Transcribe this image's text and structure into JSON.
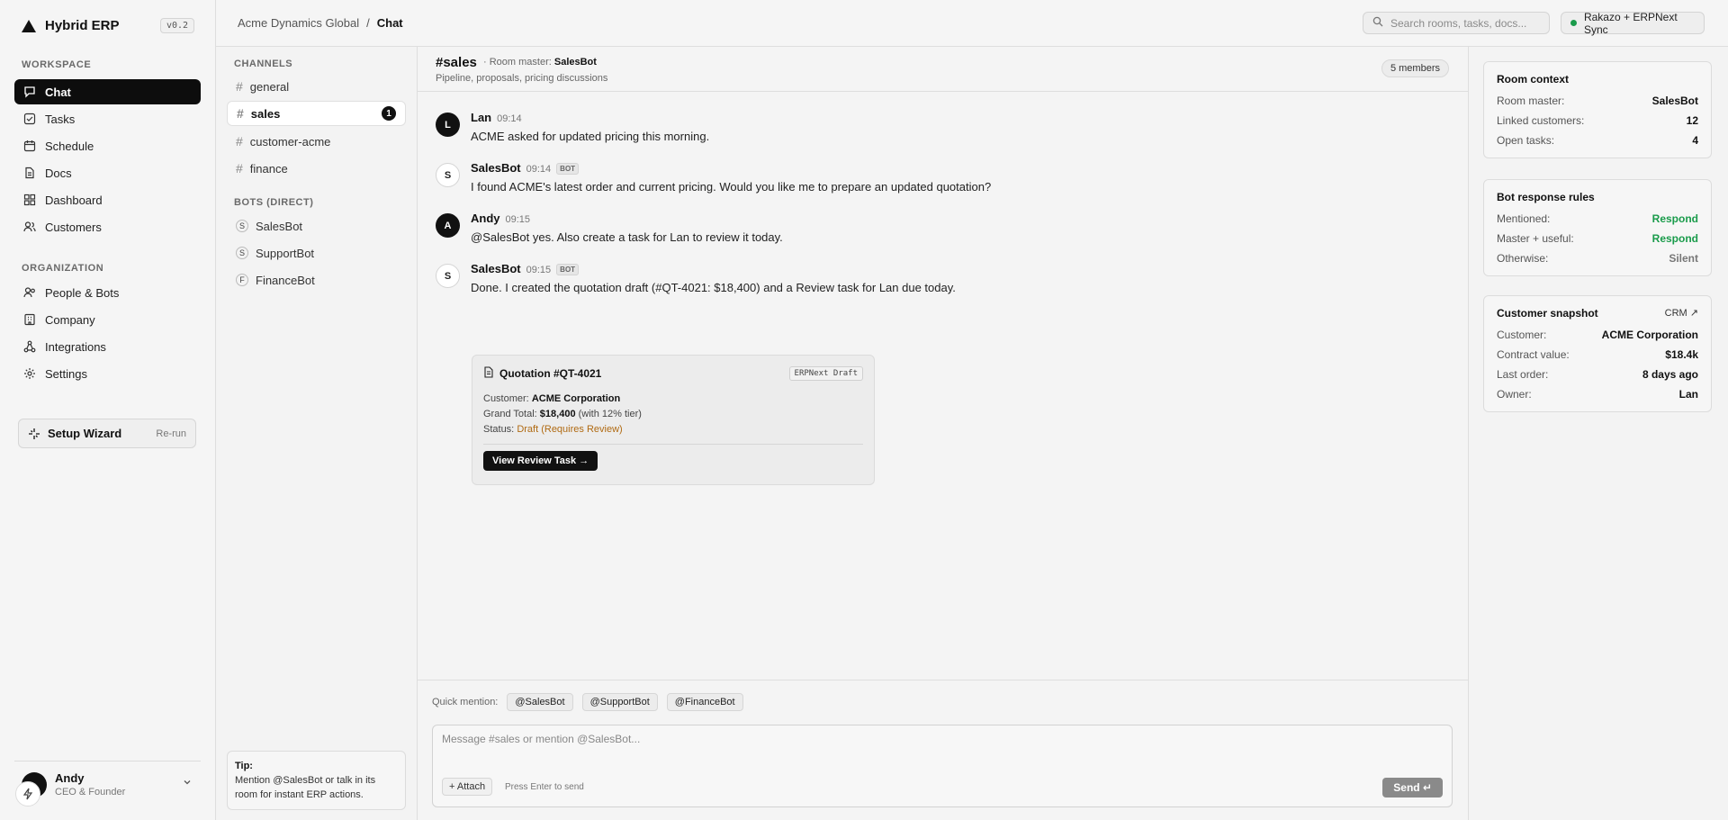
{
  "app": {
    "name": "Hybrid ERP",
    "version": "v0.2"
  },
  "sidebar": {
    "workspace_label": "WORKSPACE",
    "workspace_items": [
      {
        "label": "Chat",
        "icon": "chat-icon"
      },
      {
        "label": "Tasks",
        "icon": "tasks-icon"
      },
      {
        "label": "Schedule",
        "icon": "calendar-icon"
      },
      {
        "label": "Docs",
        "icon": "document-icon"
      },
      {
        "label": "Dashboard",
        "icon": "dashboard-icon"
      },
      {
        "label": "Customers",
        "icon": "users-icon"
      }
    ],
    "organization_label": "ORGANIZATION",
    "organization_items": [
      {
        "label": "People & Bots",
        "icon": "people-icon"
      },
      {
        "label": "Company",
        "icon": "building-icon"
      },
      {
        "label": "Integrations",
        "icon": "integrations-icon"
      },
      {
        "label": "Settings",
        "icon": "gear-icon"
      }
    ],
    "setup": {
      "label": "Setup Wizard",
      "action": "Re-run"
    },
    "user": {
      "name": "Andy",
      "role": "CEO & Founder"
    }
  },
  "topbar": {
    "breadcrumb": [
      "Acme Dynamics Global",
      "/",
      "Chat"
    ],
    "search_placeholder": "Search rooms, tasks, docs...",
    "sync_label": "Rakazo + ERPNext Sync"
  },
  "channels": {
    "channels_label": "CHANNELS",
    "channel_items": [
      {
        "label": "general"
      },
      {
        "label": "sales",
        "unread": "1"
      },
      {
        "label": "customer-acme"
      },
      {
        "label": "finance"
      }
    ],
    "bots_label": "BOTS (DIRECT)",
    "bot_items": [
      {
        "label": "SalesBot",
        "letter": "S"
      },
      {
        "label": "SupportBot",
        "letter": "S"
      },
      {
        "label": "FinanceBot",
        "letter": "F"
      }
    ],
    "tip": {
      "title": "Tip:",
      "text": "Mention @SalesBot or talk in its room for instant ERP actions."
    }
  },
  "room": {
    "name": "#sales",
    "master_prefix": "· Room master:",
    "master": "SalesBot",
    "description": "Pipeline, proposals, pricing discussions",
    "members": "5 members"
  },
  "messages": [
    {
      "author": "Lan",
      "initial": "L",
      "time": "09:14",
      "bot": false,
      "text": "ACME asked for updated pricing this morning."
    },
    {
      "author": "SalesBot",
      "initial": "S",
      "time": "09:14",
      "bot": true,
      "text": "I found ACME's latest order and current pricing. Would you like me to prepare an updated quotation?"
    },
    {
      "author": "Andy",
      "initial": "A",
      "time": "09:15",
      "bot": false,
      "text": "@SalesBot yes. Also create a task for Lan to review it today."
    },
    {
      "author": "SalesBot",
      "initial": "S",
      "time": "09:15",
      "bot": true,
      "text": "Done. I created the quotation draft (#QT-4021: $18,400) and a Review task for Lan due today."
    }
  ],
  "bot_tag": "BOT",
  "quotation": {
    "title": "Quotation #QT-4021",
    "tag": "ERPNext Draft",
    "customer_label": "Customer:",
    "customer": "ACME Corporation",
    "total_label": "Grand Total:",
    "total": "$18,400",
    "total_note": "(with 12% tier)",
    "status_label": "Status:",
    "status": "Draft (Requires Review)",
    "button": "View Review Task →"
  },
  "composer": {
    "quick_mention_label": "Quick mention:",
    "mentions": [
      "@SalesBot",
      "@SupportBot",
      "@FinanceBot"
    ],
    "placeholder": "Message #sales or mention @SalesBot...",
    "attach": "+ Attach",
    "hint": "Press Enter to send",
    "send": "Send ↵"
  },
  "context": {
    "room_context": {
      "title": "Room context",
      "rows": [
        {
          "label": "Room master:",
          "value": "SalesBot"
        },
        {
          "label": "Linked customers:",
          "value": "12"
        },
        {
          "label": "Open tasks:",
          "value": "4"
        }
      ]
    },
    "rules": {
      "title": "Bot response rules",
      "rows": [
        {
          "label": "Mentioned:",
          "value": "Respond"
        },
        {
          "label": "Master + useful:",
          "value": "Respond"
        },
        {
          "label": "Otherwise:",
          "value": "Silent"
        }
      ]
    },
    "snapshot": {
      "title": "Customer snapshot",
      "link": "CRM ↗",
      "rows": [
        {
          "label": "Customer:",
          "value": "ACME Corporation"
        },
        {
          "label": "Contract value:",
          "value": "$18.4k"
        },
        {
          "label": "Last order:",
          "value": "8 days ago"
        },
        {
          "label": "Owner:",
          "value": "Lan"
        }
      ]
    }
  },
  "colors": {
    "accent": "#0d0d0d",
    "positive": "#1a9b4b",
    "draft": "#b06a12"
  }
}
